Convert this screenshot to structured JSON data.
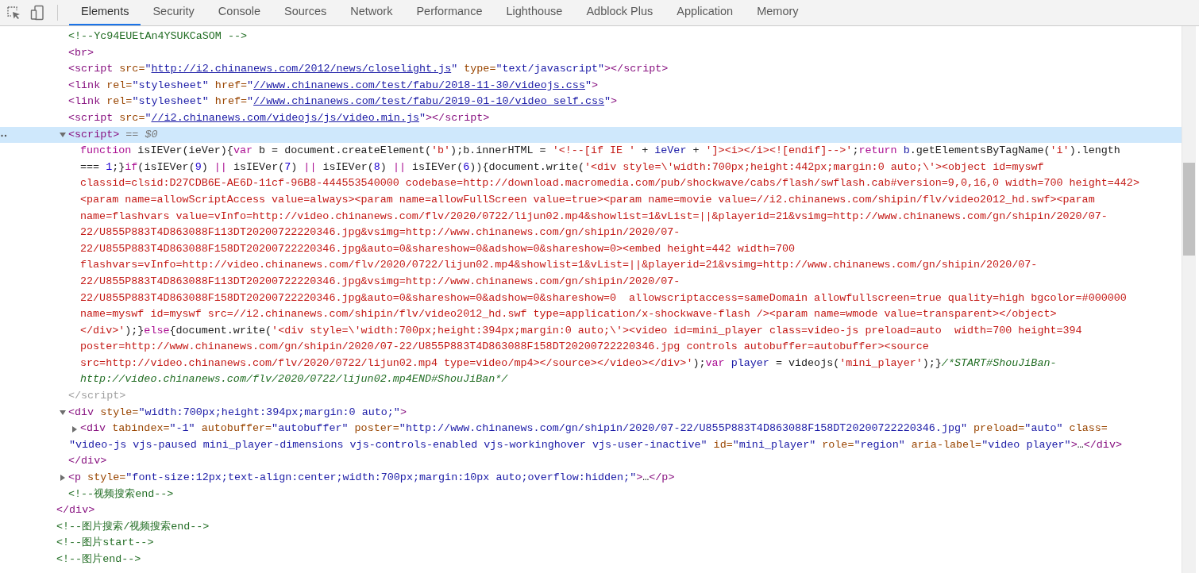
{
  "tabs": [
    {
      "label": "Elements",
      "selected": true
    },
    {
      "label": "Security",
      "selected": false
    },
    {
      "label": "Console",
      "selected": false
    },
    {
      "label": "Sources",
      "selected": false
    },
    {
      "label": "Network",
      "selected": false
    },
    {
      "label": "Performance",
      "selected": false
    },
    {
      "label": "Lighthouse",
      "selected": false
    },
    {
      "label": "Adblock Plus",
      "selected": false
    },
    {
      "label": "Application",
      "selected": false
    },
    {
      "label": "Memory",
      "selected": false
    }
  ],
  "tree": [
    {
      "children": [
        {
          "lines": [
            [
              {
                "kind": "comment",
                "text": "<!--Yc94EUEtAn4YSUKCaSOM -->"
              }
            ]
          ]
        },
        {
          "lines": [
            [
              {
                "kind": "tag",
                "text": "<br>"
              }
            ]
          ]
        },
        {
          "lines": [
            [
              {
                "kind": "tag",
                "text": "<script"
              },
              {
                "kind": "attr",
                "text": " src="
              },
              {
                "kind": "value",
                "text": "\""
              },
              {
                "kind": "link",
                "text": "http://i2.chinanews.com/2012/news/closelight.js"
              },
              {
                "kind": "value",
                "text": "\""
              },
              {
                "kind": "attr",
                "text": " type="
              },
              {
                "kind": "value",
                "text": "\"text/javascript\""
              },
              {
                "kind": "tag",
                "text": "></script>"
              }
            ]
          ]
        },
        {
          "lines": [
            [
              {
                "kind": "tag",
                "text": "<link"
              },
              {
                "kind": "attr",
                "text": " rel="
              },
              {
                "kind": "value",
                "text": "\"stylesheet\""
              },
              {
                "kind": "attr",
                "text": " href="
              },
              {
                "kind": "value",
                "text": "\""
              },
              {
                "kind": "link",
                "text": "//www.chinanews.com/test/fabu/2018-11-30/videojs.css"
              },
              {
                "kind": "value",
                "text": "\""
              },
              {
                "kind": "tag",
                "text": ">"
              }
            ]
          ]
        },
        {
          "lines": [
            [
              {
                "kind": "tag",
                "text": "<link"
              },
              {
                "kind": "attr",
                "text": " rel="
              },
              {
                "kind": "value",
                "text": "\"stylesheet\""
              },
              {
                "kind": "attr",
                "text": " href="
              },
              {
                "kind": "value",
                "text": "\""
              },
              {
                "kind": "link",
                "text": "//www.chinanews.com/test/fabu/2019-01-10/video_self.css"
              },
              {
                "kind": "value",
                "text": "\""
              },
              {
                "kind": "tag",
                "text": ">"
              }
            ]
          ]
        },
        {
          "lines": [
            [
              {
                "kind": "tag",
                "text": "<script"
              },
              {
                "kind": "attr",
                "text": " src="
              },
              {
                "kind": "value",
                "text": "\""
              },
              {
                "kind": "link",
                "text": "//i2.chinanews.com/videojs/js/video.min.js"
              },
              {
                "kind": "value",
                "text": "\""
              },
              {
                "kind": "tag",
                "text": "></script>"
              }
            ]
          ]
        },
        {
          "expanded": true,
          "selected": true,
          "lines": [
            [
              {
                "kind": "tag",
                "text": "<script>"
              },
              {
                "kind": "dim",
                "text": " == $0"
              }
            ]
          ],
          "close": [
            {
              "kind": "dimtag",
              "text": "</script>"
            }
          ],
          "children": [
            {
              "lines": [
                [
                  {
                    "kind": "kw",
                    "text": "function"
                  },
                  {
                    "kind": "plain",
                    "text": " isIEVer(ieVer){"
                  },
                  {
                    "kind": "kw",
                    "text": "var"
                  },
                  {
                    "kind": "plain",
                    "text": " b = document.createElement("
                  },
                  {
                    "kind": "str",
                    "text": "'b'"
                  },
                  {
                    "kind": "plain",
                    "text": ");b.innerHTML = "
                  },
                  {
                    "kind": "str",
                    "text": "'<!--[if IE '"
                  },
                  {
                    "kind": "plain",
                    "text": " + "
                  },
                  {
                    "kind": "var",
                    "text": "ieVer"
                  },
                  {
                    "kind": "plain",
                    "text": " + "
                  },
                  {
                    "kind": "str",
                    "text": "']><i></i><![endif]-->'"
                  },
                  {
                    "kind": "plain",
                    "text": ";"
                  },
                  {
                    "kind": "kw",
                    "text": "return"
                  },
                  {
                    "kind": "var",
                    "text": " b"
                  },
                  {
                    "kind": "plain",
                    "text": ".getElementsByTagName("
                  },
                  {
                    "kind": "str",
                    "text": "'i'"
                  },
                  {
                    "kind": "plain",
                    "text": ").length"
                  }
                ],
                [
                  {
                    "kind": "plain",
                    "text": "=== "
                  },
                  {
                    "kind": "num",
                    "text": "1"
                  },
                  {
                    "kind": "plain",
                    "text": ";}"
                  },
                  {
                    "kind": "kw",
                    "text": "if"
                  },
                  {
                    "kind": "plain",
                    "text": "(isIEVer("
                  },
                  {
                    "kind": "num",
                    "text": "9"
                  },
                  {
                    "kind": "plain",
                    "text": ") "
                  },
                  {
                    "kind": "kw",
                    "text": "||"
                  },
                  {
                    "kind": "plain",
                    "text": " isIEVer("
                  },
                  {
                    "kind": "num",
                    "text": "7"
                  },
                  {
                    "kind": "plain",
                    "text": ") "
                  },
                  {
                    "kind": "kw",
                    "text": "||"
                  },
                  {
                    "kind": "plain",
                    "text": " isIEVer("
                  },
                  {
                    "kind": "num",
                    "text": "8"
                  },
                  {
                    "kind": "plain",
                    "text": ") "
                  },
                  {
                    "kind": "kw",
                    "text": "||"
                  },
                  {
                    "kind": "plain",
                    "text": " isIEVer("
                  },
                  {
                    "kind": "num",
                    "text": "6"
                  },
                  {
                    "kind": "plain",
                    "text": ")){document.write("
                  },
                  {
                    "kind": "str",
                    "text": "'<div style=\\'width:700px;height:442px;margin:0 auto;\\'><object id=myswf"
                  }
                ],
                [
                  {
                    "kind": "str",
                    "text": "classid=clsid:D27CDB6E-AE6D-11cf-96B8-444553540000 codebase=http://download.macromedia.com/pub/shockwave/cabs/flash/swflash.cab#version=9,0,16,0 width=700 height=442>"
                  }
                ],
                [
                  {
                    "kind": "str",
                    "text": "<param name=allowScriptAccess value=always><param name=allowFullScreen value=true><param name=movie value=//i2.chinanews.com/shipin/flv/video2012_hd.swf><param"
                  }
                ],
                [
                  {
                    "kind": "str",
                    "text": "name=flashvars value=vInfo=http://video.chinanews.com/flv/2020/0722/lijun02.mp4&showlist=1&vList=||&playerid=21&vsimg=http://www.chinanews.com/gn/shipin/2020/07-"
                  }
                ],
                [
                  {
                    "kind": "str",
                    "text": "22/U855P883T4D863088F113DT20200722220346.jpg&vsimg=http://www.chinanews.com/gn/shipin/2020/07-"
                  }
                ],
                [
                  {
                    "kind": "str",
                    "text": "22/U855P883T4D863088F158DT20200722220346.jpg&auto=0&shareshow=0&adshow=0&shareshow=0><embed height=442 width=700"
                  }
                ],
                [
                  {
                    "kind": "str",
                    "text": "flashvars=vInfo=http://video.chinanews.com/flv/2020/0722/lijun02.mp4&showlist=1&vList=||&playerid=21&vsimg=http://www.chinanews.com/gn/shipin/2020/07-"
                  }
                ],
                [
                  {
                    "kind": "str",
                    "text": "22/U855P883T4D863088F113DT20200722220346.jpg&vsimg=http://www.chinanews.com/gn/shipin/2020/07-"
                  }
                ],
                [
                  {
                    "kind": "str",
                    "text": "22/U855P883T4D863088F158DT20200722220346.jpg&auto=0&shareshow=0&adshow=0&shareshow=0  allowscriptaccess=sameDomain allowfullscreen=true quality=high bgcolor=#000000"
                  }
                ],
                [
                  {
                    "kind": "str",
                    "text": "name=myswf id=myswf src=//i2.chinanews.com/shipin/flv/video2012_hd.swf type=application/x-shockwave-flash /><param name=wmode value=transparent></object>"
                  }
                ],
                [
                  {
                    "kind": "str",
                    "text": "</div>'"
                  },
                  {
                    "kind": "plain",
                    "text": ");}"
                  },
                  {
                    "kind": "kw",
                    "text": "else"
                  },
                  {
                    "kind": "plain",
                    "text": "{document.write("
                  },
                  {
                    "kind": "str",
                    "text": "'<div style=\\'width:700px;height:394px;margin:0 auto;\\'><video id=mini_player class=video-js preload=auto  width=700 height=394"
                  }
                ],
                [
                  {
                    "kind": "str",
                    "text": "poster=http://www.chinanews.com/gn/shipin/2020/07-22/U855P883T4D863088F158DT20200722220346.jpg controls autobuffer=autobuffer><source"
                  }
                ],
                [
                  {
                    "kind": "str",
                    "text": "src=http://video.chinanews.com/flv/2020/0722/lijun02.mp4 type=video/mp4></source></video></div>'"
                  },
                  {
                    "kind": "plain",
                    "text": ");"
                  },
                  {
                    "kind": "kw",
                    "text": "var"
                  },
                  {
                    "kind": "var",
                    "text": " player"
                  },
                  {
                    "kind": "plain",
                    "text": " = videojs("
                  },
                  {
                    "kind": "str",
                    "text": "'mini_player'"
                  },
                  {
                    "kind": "plain",
                    "text": ");}"
                  },
                  {
                    "kind": "jscomment",
                    "text": "/*START#ShouJiBan-"
                  }
                ],
                [
                  {
                    "kind": "jscomment",
                    "text": "http://video.chinanews.com/flv/2020/0722/lijun02.mp4END#ShouJiBan*/"
                  }
                ]
              ]
            }
          ]
        },
        {
          "expanded": true,
          "lines": [
            [
              {
                "kind": "tag",
                "text": "<div"
              },
              {
                "kind": "attr",
                "text": " style="
              },
              {
                "kind": "value",
                "text": "\"width:700px;height:394px;margin:0 auto;\""
              },
              {
                "kind": "tag",
                "text": ">"
              }
            ]
          ],
          "close": [
            {
              "kind": "tag",
              "text": "</div>"
            }
          ],
          "children": [
            {
              "expanded": false,
              "lines": [
                [
                  {
                    "kind": "tag",
                    "text": "<div"
                  },
                  {
                    "kind": "attr",
                    "text": " tabindex="
                  },
                  {
                    "kind": "value",
                    "text": "\"-1\""
                  },
                  {
                    "kind": "attr",
                    "text": " autobuffer="
                  },
                  {
                    "kind": "value",
                    "text": "\"autobuffer\""
                  },
                  {
                    "kind": "attr",
                    "text": " poster="
                  },
                  {
                    "kind": "value",
                    "text": "\"http://www.chinanews.com/gn/shipin/2020/07-22/U855P883T4D863088F158DT20200722220346.jpg\""
                  },
                  {
                    "kind": "attr",
                    "text": " preload="
                  },
                  {
                    "kind": "value",
                    "text": "\"auto\""
                  },
                  {
                    "kind": "attr",
                    "text": " class="
                  }
                ],
                [
                  {
                    "kind": "value",
                    "text": "\"video-js vjs-paused mini_player-dimensions vjs-controls-enabled vjs-workinghover vjs-user-inactive\""
                  },
                  {
                    "kind": "attr",
                    "text": " id="
                  },
                  {
                    "kind": "value",
                    "text": "\"mini_player\""
                  },
                  {
                    "kind": "attr",
                    "text": " role="
                  },
                  {
                    "kind": "value",
                    "text": "\"region\""
                  },
                  {
                    "kind": "attr",
                    "text": " aria-label="
                  },
                  {
                    "kind": "value",
                    "text": "\"video player\""
                  },
                  {
                    "kind": "tag",
                    "text": ">"
                  },
                  {
                    "kind": "plain",
                    "text": "…"
                  },
                  {
                    "kind": "tag",
                    "text": "</div>"
                  }
                ]
              ]
            }
          ]
        },
        {
          "expanded": false,
          "lines": [
            [
              {
                "kind": "tag",
                "text": "<p"
              },
              {
                "kind": "attr",
                "text": " style="
              },
              {
                "kind": "value",
                "text": "\"font-size:12px;text-align:center;width:700px;margin:10px auto;overflow:hidden;\""
              },
              {
                "kind": "tag",
                "text": ">"
              },
              {
                "kind": "plain",
                "text": "…"
              },
              {
                "kind": "tag",
                "text": "</p>"
              }
            ]
          ]
        },
        {
          "lines": [
            [
              {
                "kind": "comment",
                "text": "<!--视频搜索end-->"
              }
            ]
          ]
        }
      ],
      "close": [
        {
          "kind": "tag",
          "text": "</div>"
        }
      ]
    },
    {
      "lines": [
        [
          {
            "kind": "comment",
            "text": "<!--图片搜索/视频搜索end-->"
          }
        ]
      ]
    },
    {
      "lines": [
        [
          {
            "kind": "comment",
            "text": "<!--图片start-->"
          }
        ]
      ]
    },
    {
      "lines": [
        [
          {
            "kind": "comment",
            "text": "<!--图片end-->"
          }
        ]
      ]
    }
  ]
}
